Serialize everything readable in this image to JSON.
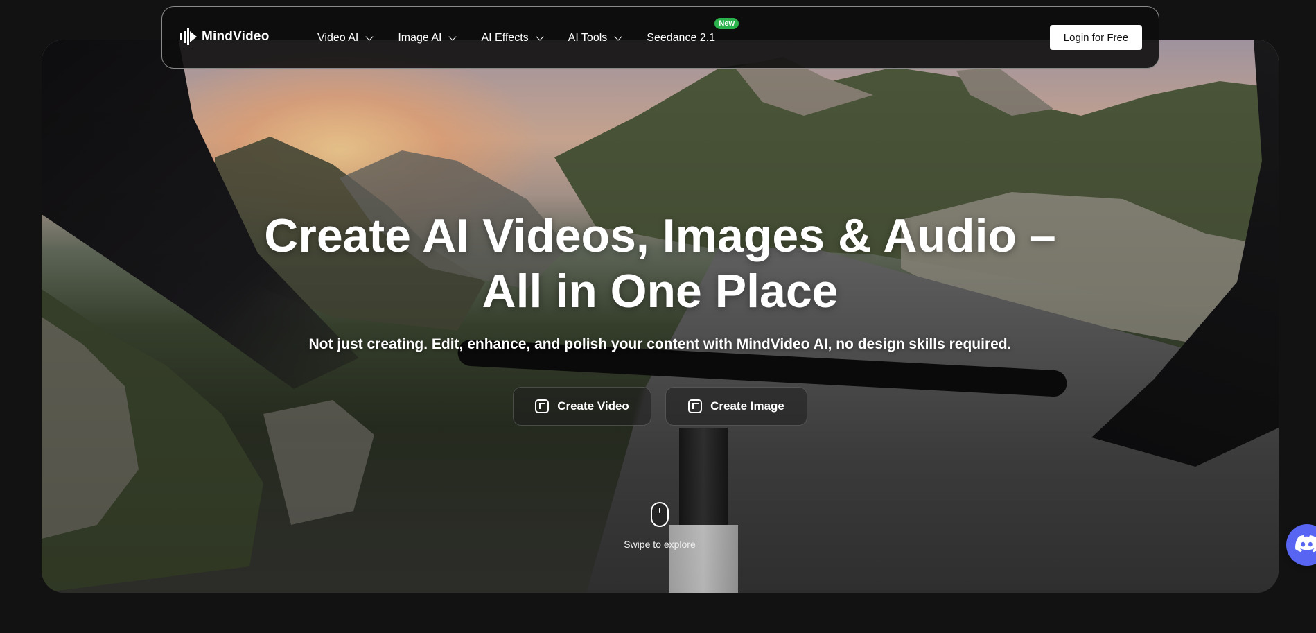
{
  "brand": {
    "name": "MindVideo"
  },
  "nav": {
    "items": [
      {
        "label": "Video AI",
        "has_dropdown": true
      },
      {
        "label": "Image AI",
        "has_dropdown": true
      },
      {
        "label": "AI Effects",
        "has_dropdown": true
      },
      {
        "label": "AI Tools",
        "has_dropdown": true
      },
      {
        "label": "Seedance 2.1",
        "has_dropdown": false,
        "badge": "New"
      }
    ],
    "login_label": "Login for Free"
  },
  "hero": {
    "headline_line1": "Create AI Videos, Images & Audio –",
    "headline_line2": "All in One Place",
    "subheadline": "Not just creating. Edit, enhance, and polish your content with MindVideo AI, no design skills required.",
    "cta_video": "Create Video",
    "cta_image": "Create Image",
    "scroll_hint": "Swipe to explore"
  },
  "colors": {
    "accent_badge": "#2bb24c",
    "discord": "#5865f2",
    "page_bg": "#121212"
  },
  "icons": [
    "logo-icon",
    "chevron-down-icon",
    "video-create-icon",
    "image-create-icon",
    "mouse-scroll-icon",
    "discord-icon"
  ]
}
